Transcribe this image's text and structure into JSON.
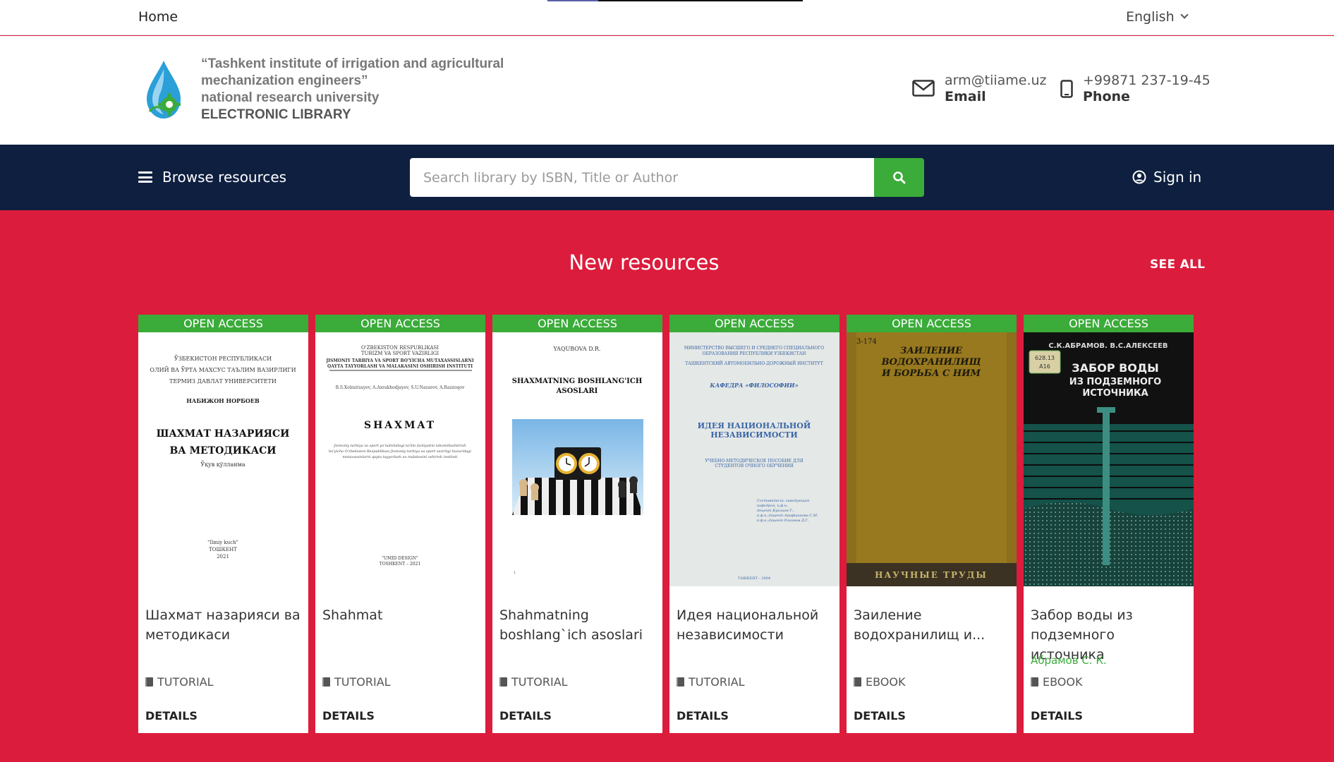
{
  "topbar": {
    "home": "Home",
    "language": "English"
  },
  "brand": {
    "line1": "“Tashkent institute of irrigation and agricultural",
    "line2": "mechanization engineers”",
    "line3": "national research university",
    "line4": "ELECTRONIC LIBRARY"
  },
  "contacts": {
    "email_value": "arm@tiiame.uz",
    "email_label": "Email",
    "phone_value": "+99871 237-19-45",
    "phone_label": "Phone"
  },
  "nav": {
    "browse": "Browse resources",
    "search_placeholder": "Search library by ISBN, Title or Author",
    "signin": "Sign in"
  },
  "section": {
    "title": "New resources",
    "see_all": "SEE ALL"
  },
  "colors": {
    "accent_red": "#dc1c3c",
    "nav_navy": "#0e1f3f",
    "green": "#3bab3a"
  },
  "cards": [
    {
      "badge": "OPEN ACCESS",
      "title": "Шахмат назарияси ва методикаси",
      "author": "",
      "type": "TUTORIAL",
      "details": "DETAILS",
      "cover": {
        "head1": "ЎЗБЕКИСТОН РЕСПУБЛИКАСИ",
        "head2": "ОЛИЙ ВА ЎРТА МАХСУС ТАЪЛИМ ВАЗИРЛИГИ",
        "head3": "ТЕРМИЗ ДАВЛАТ УНИВЕРСИТЕТИ",
        "author": "НАБИЖОН НОРБОЕВ",
        "title1": "ШАХМАТ НАЗАРИЯСИ",
        "title2": "ВА МЕТОДИКАСИ",
        "sub": "Ўқув қўлланма",
        "pub1": "\"Ilmiy kuch\"",
        "pub2": "ТОШКЕНТ",
        "year": "2021"
      }
    },
    {
      "badge": "OPEN ACCESS",
      "title": "Shahmat",
      "author": "",
      "type": "TUTORIAL",
      "details": "DETAILS",
      "cover": {
        "head1": "O'ZBEKISTON RESPUBLIKASI",
        "head2": "TURIZM VA SPORT VAZIRLIGI",
        "head3": "JISMONIY TARBIYA VA SPORT BO'YICHA MUTAXASSISLARNI",
        "head4": "QAYTA TAYYORLASH VA MALAKASINI OSHIRISH INSTITUTI",
        "authors": "B.S.Xolmirzayev, A.Axrakhodjayev, S.U.Nazarov, A.Razzoqov",
        "title": "SHAXMAT",
        "desc1": "Jismoniy tarbiya va sport yo'nalishidagi ta'lim faoliyatini takomillashtirish",
        "desc2": "bo'yicha O'zbekiston Respublikasi Jismoniy tarbiya va sport vazirligi huzuridagi",
        "desc3": "mutaxassislarni qayta tayyorlash va malakasini oshirish instituti",
        "pub": "\"UMID DESIGN\"",
        "year": "TOSHKENT – 2021"
      }
    },
    {
      "badge": "OPEN ACCESS",
      "title": "Shahmatning boshlang`ich asoslari",
      "author": "",
      "type": "TUTORIAL",
      "details": "DETAILS",
      "cover": {
        "author": "YAQUBOVA D.R.",
        "title1": "SHAXMATNING BOSHLANG'ICH",
        "title2": "ASOSLARI",
        "page": "1"
      }
    },
    {
      "badge": "OPEN ACCESS",
      "title": "Идея национальной независимости",
      "author": "",
      "type": "TUTORIAL",
      "details": "DETAILS",
      "cover": {
        "head1": "МИНИСТЕРСТВО ВЫСШЕГО И СРЕДНЕГО СПЕЦИАЛЬНОГО",
        "head2": "ОБРАЗОВАНИЯ РЕСПУБЛИКИ УЗБЕКИСТАН",
        "head3": "ТАШКЕНТСКИЙ АВТОМОБИЛЬНО-ДОРОЖНЫЙ ИНСТИТУТ",
        "dept": "КАФЕДРА «ФИЛОСОФИИ»",
        "title1": "ИДЕЯ НАЦИОНАЛЬНОЙ",
        "title2": "НЕЗАВИСИМОСТИ",
        "sub1": "УЧЕБНО-МЕТОДИЧЕСКОЕ ПОСОБИЕ ДЛЯ",
        "sub2": "СТУДЕНТОВ ОЧНОГО ОБУЧЕНИЯ",
        "comp1": "Составители: заведующий",
        "comp2": "кафедрой, к.ф.н.,",
        "comp3": "доцент Куйлиев Т.,",
        "comp4": "к.ф.н.,доцент Арифшанова С.М.",
        "comp5": "к.ф.н.,доцент Рахимов Д.Г.",
        "year": "ТАШКЕНТ – 2004"
      }
    },
    {
      "badge": "OPEN ACCESS",
      "title": "Заиление водохранилищ и...",
      "author": "",
      "type": "EBOOK",
      "details": "DETAILS",
      "cover": {
        "mark": "3-174",
        "title1": "ЗАИЛЕНИЕ",
        "title2": "ВОДОХРАНИЛИЩ",
        "title3": "И БОРЬБА С НИМ",
        "series": "НАУЧНЫЕ ТРУДЫ"
      }
    },
    {
      "badge": "OPEN ACCESS",
      "title": "Забор воды из подземного источника",
      "author": "Абрамов С. К.",
      "type": "EBOOK",
      "details": "DETAILS",
      "cover": {
        "authors": "С.К.АБРАМОВ. В.С.АЛЕКСЕЕВ",
        "stamp1": "628.13",
        "stamp2": "А16",
        "title1": "ЗАБОР ВОДЫ",
        "title2": "ИЗ ПОДЗЕМНОГО",
        "title3": "ИСТОЧНИКА"
      }
    }
  ]
}
